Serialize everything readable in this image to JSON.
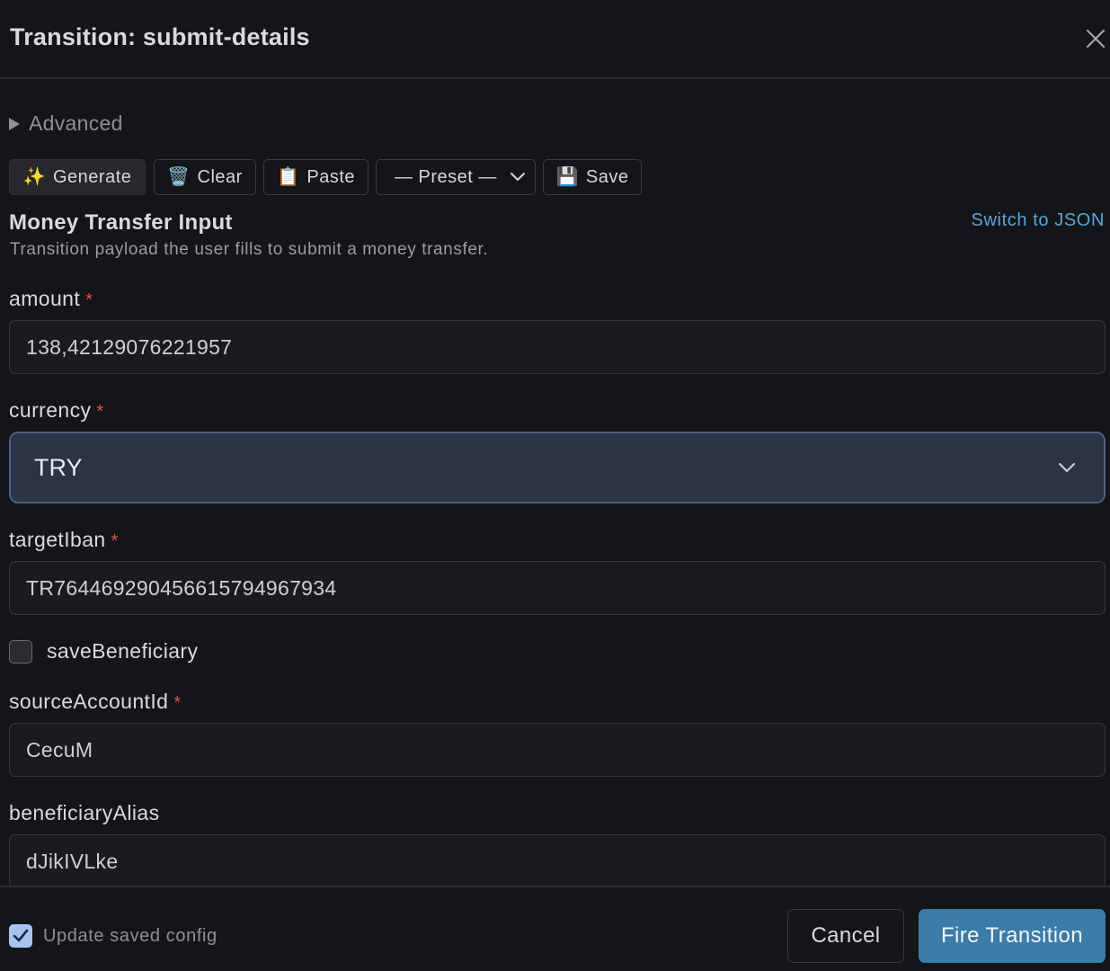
{
  "dialog": {
    "title": "Transition: submit-details",
    "close_icon": "close-icon"
  },
  "advanced": {
    "label": "Advanced",
    "expanded": false
  },
  "toolbar": {
    "generate": {
      "icon": "✨",
      "label": "Generate"
    },
    "clear": {
      "icon": "🗑️",
      "label": "Clear"
    },
    "paste": {
      "icon": "📋",
      "label": "Paste"
    },
    "preset": {
      "label": "— Preset —"
    },
    "save": {
      "icon": "💾",
      "label": "Save"
    }
  },
  "form": {
    "title": "Money Transfer Input",
    "description": "Transition payload the user fills to submit a money transfer.",
    "switch_label": "Switch to JSON",
    "required_mark": "*",
    "fields": {
      "amount": {
        "label": "amount",
        "value": "138,42129076221957",
        "required": true
      },
      "currency": {
        "label": "currency",
        "value": "TRY",
        "required": true
      },
      "targetIban": {
        "label": "targetIban",
        "value": "TR764469290456615794967934",
        "required": true
      },
      "saveBeneficiary": {
        "label": "saveBeneficiary",
        "checked": false
      },
      "sourceAccountId": {
        "label": "sourceAccountId",
        "value": "CecuM",
        "required": true
      },
      "beneficiaryAlias": {
        "label": "beneficiaryAlias",
        "value": "dJikIVLke",
        "required": false
      }
    }
  },
  "footer": {
    "update_label": "Update saved config",
    "update_checked": true,
    "cancel_label": "Cancel",
    "fire_label": "Fire Transition"
  },
  "colors": {
    "background": "#141518",
    "accent": "#3b7ca8",
    "link": "#5aa6d8",
    "required": "#e05353",
    "select_bg": "#2b3447"
  }
}
